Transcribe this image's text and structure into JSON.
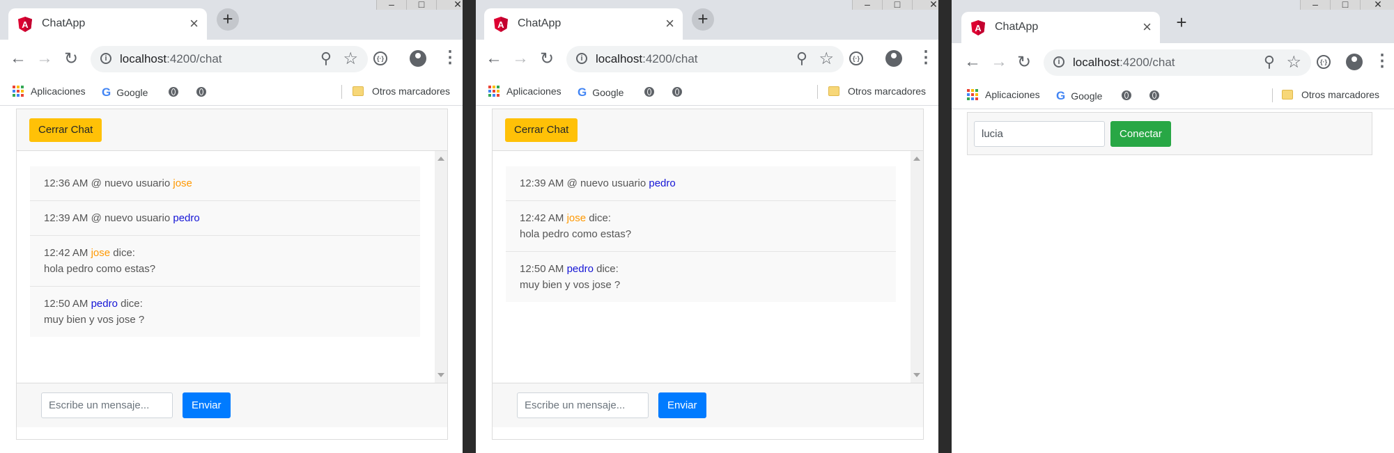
{
  "browser": {
    "tab_title": "ChatApp",
    "url_host": "localhost",
    "url_path": ":4200/chat",
    "bookmarks": {
      "apps": "Aplicaciones",
      "google": "Google",
      "others": "Otros marcadores"
    }
  },
  "chat": {
    "close_button": "Cerrar Chat",
    "message_placeholder": "Escribe un mensaje...",
    "send_button": "Enviar",
    "join_text": "@ nuevo usuario",
    "says_text": "dice:"
  },
  "window1": {
    "messages": [
      {
        "time": "12:36 AM",
        "user": "jose",
        "text": ""
      },
      {
        "time": "12:39 AM",
        "user": "pedro",
        "text": ""
      },
      {
        "time": "12:42 AM",
        "user": "jose",
        "text": "hola pedro como estas?"
      },
      {
        "time": "12:50 AM",
        "user": "pedro",
        "text": "muy bien y vos jose ?"
      }
    ]
  },
  "window2": {
    "messages": [
      {
        "time": "12:39 AM",
        "user": "pedro",
        "text": ""
      },
      {
        "time": "12:42 AM",
        "user": "jose",
        "text": "hola pedro como estas?"
      },
      {
        "time": "12:50 AM",
        "user": "pedro",
        "text": "muy bien y vos jose ?"
      }
    ]
  },
  "window3": {
    "name_value": "lucia",
    "connect_button": "Conectar"
  },
  "colors": {
    "user_jose": "#ff9800",
    "user_pedro": "#1515d6",
    "warning": "#ffc107",
    "primary": "#007bff",
    "success": "#28a745"
  }
}
